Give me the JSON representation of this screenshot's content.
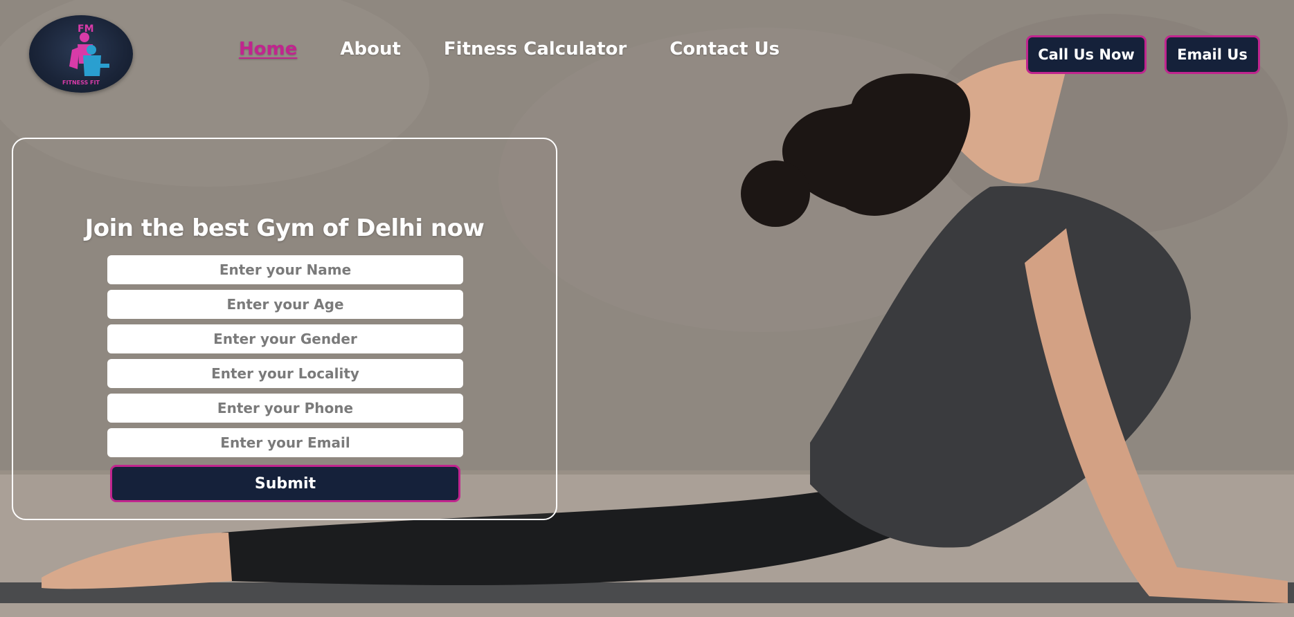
{
  "brand": {
    "logo_text": "FITNESS FIT",
    "logo_initials": "FM",
    "logo_icon": "fitness-figure-icon"
  },
  "nav": {
    "items": [
      {
        "label": "Home",
        "active": true
      },
      {
        "label": "About",
        "active": false
      },
      {
        "label": "Fitness Calculator",
        "active": false
      },
      {
        "label": "Contact Us",
        "active": false
      }
    ]
  },
  "actions": {
    "call_label": "Call Us Now",
    "email_label": "Email Us"
  },
  "form": {
    "title": "Join the best Gym of Delhi now",
    "fields": [
      {
        "placeholder": "Enter your Name",
        "value": ""
      },
      {
        "placeholder": "Enter your Age",
        "value": ""
      },
      {
        "placeholder": "Enter your Gender",
        "value": ""
      },
      {
        "placeholder": "Enter your Locality",
        "value": ""
      },
      {
        "placeholder": "Enter your Phone",
        "value": ""
      },
      {
        "placeholder": "Enter your Email",
        "value": ""
      }
    ],
    "submit_label": "Submit"
  },
  "colors": {
    "accent": "#c0258e",
    "button_bg": "#15213a",
    "text_light": "#ffffff"
  }
}
